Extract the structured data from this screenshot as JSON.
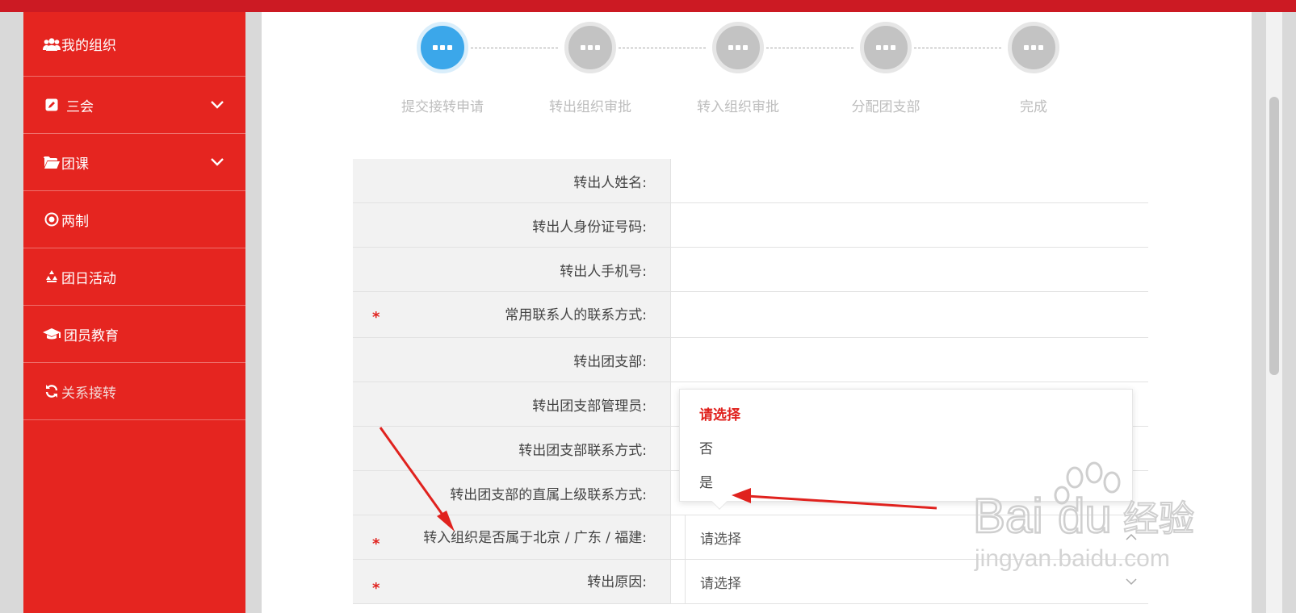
{
  "sidebar": {
    "items": [
      {
        "label": "我的组织",
        "icon": "users-icon",
        "expandable": false
      },
      {
        "label": "三会",
        "icon": "edit-icon",
        "expandable": true
      },
      {
        "label": "团课",
        "icon": "folder-open-icon",
        "expandable": true
      },
      {
        "label": "两制",
        "icon": "target-icon",
        "expandable": false
      },
      {
        "label": "团日活动",
        "icon": "recycle-icon",
        "expandable": false
      },
      {
        "label": "团员教育",
        "icon": "graduation-cap-icon",
        "expandable": false
      },
      {
        "label": "关系接转",
        "icon": "refresh-icon",
        "expandable": false,
        "active": true
      }
    ]
  },
  "steps": [
    {
      "label": "提交接转申请",
      "active": true
    },
    {
      "label": "转出组织审批",
      "active": false
    },
    {
      "label": "转入组织审批",
      "active": false
    },
    {
      "label": "分配团支部",
      "active": false
    },
    {
      "label": "完成",
      "active": false
    }
  ],
  "form": {
    "rows": [
      {
        "label": "转出人姓名:",
        "required": false,
        "value": ""
      },
      {
        "label": "转出人身份证号码:",
        "required": false,
        "value": ""
      },
      {
        "label": "转出人手机号:",
        "required": false,
        "value": ""
      },
      {
        "label": "常用联系人的联系方式:",
        "required": true,
        "value": ""
      },
      {
        "label": "转出团支部:",
        "required": false,
        "value": ""
      },
      {
        "label": "转出团支部管理员:",
        "required": false,
        "value": ""
      },
      {
        "label": "转出团支部联系方式:",
        "required": false,
        "value": ""
      },
      {
        "label": "转出团支部的直属上级联系方式:",
        "required": false,
        "value": ""
      },
      {
        "label": "转入组织是否属于北京 / 广东 / 福建:",
        "required": true,
        "select": "请选择",
        "open": true
      },
      {
        "label": "转出原因:",
        "required": true,
        "select": "请选择",
        "open": false
      }
    ]
  },
  "dropdown": {
    "options": [
      "请选择",
      "否",
      "是"
    ],
    "selected": "请选择"
  },
  "watermark": {
    "brand": "Baidu经验",
    "url": "jingyan.baidu.com"
  },
  "colors": {
    "sidebar": "#e52520",
    "topbar": "#cc1a23",
    "step_active": "#3ba7ea",
    "step_inactive": "#c3c3c3",
    "required": "#e0221e",
    "annotation": "#e0221e"
  }
}
